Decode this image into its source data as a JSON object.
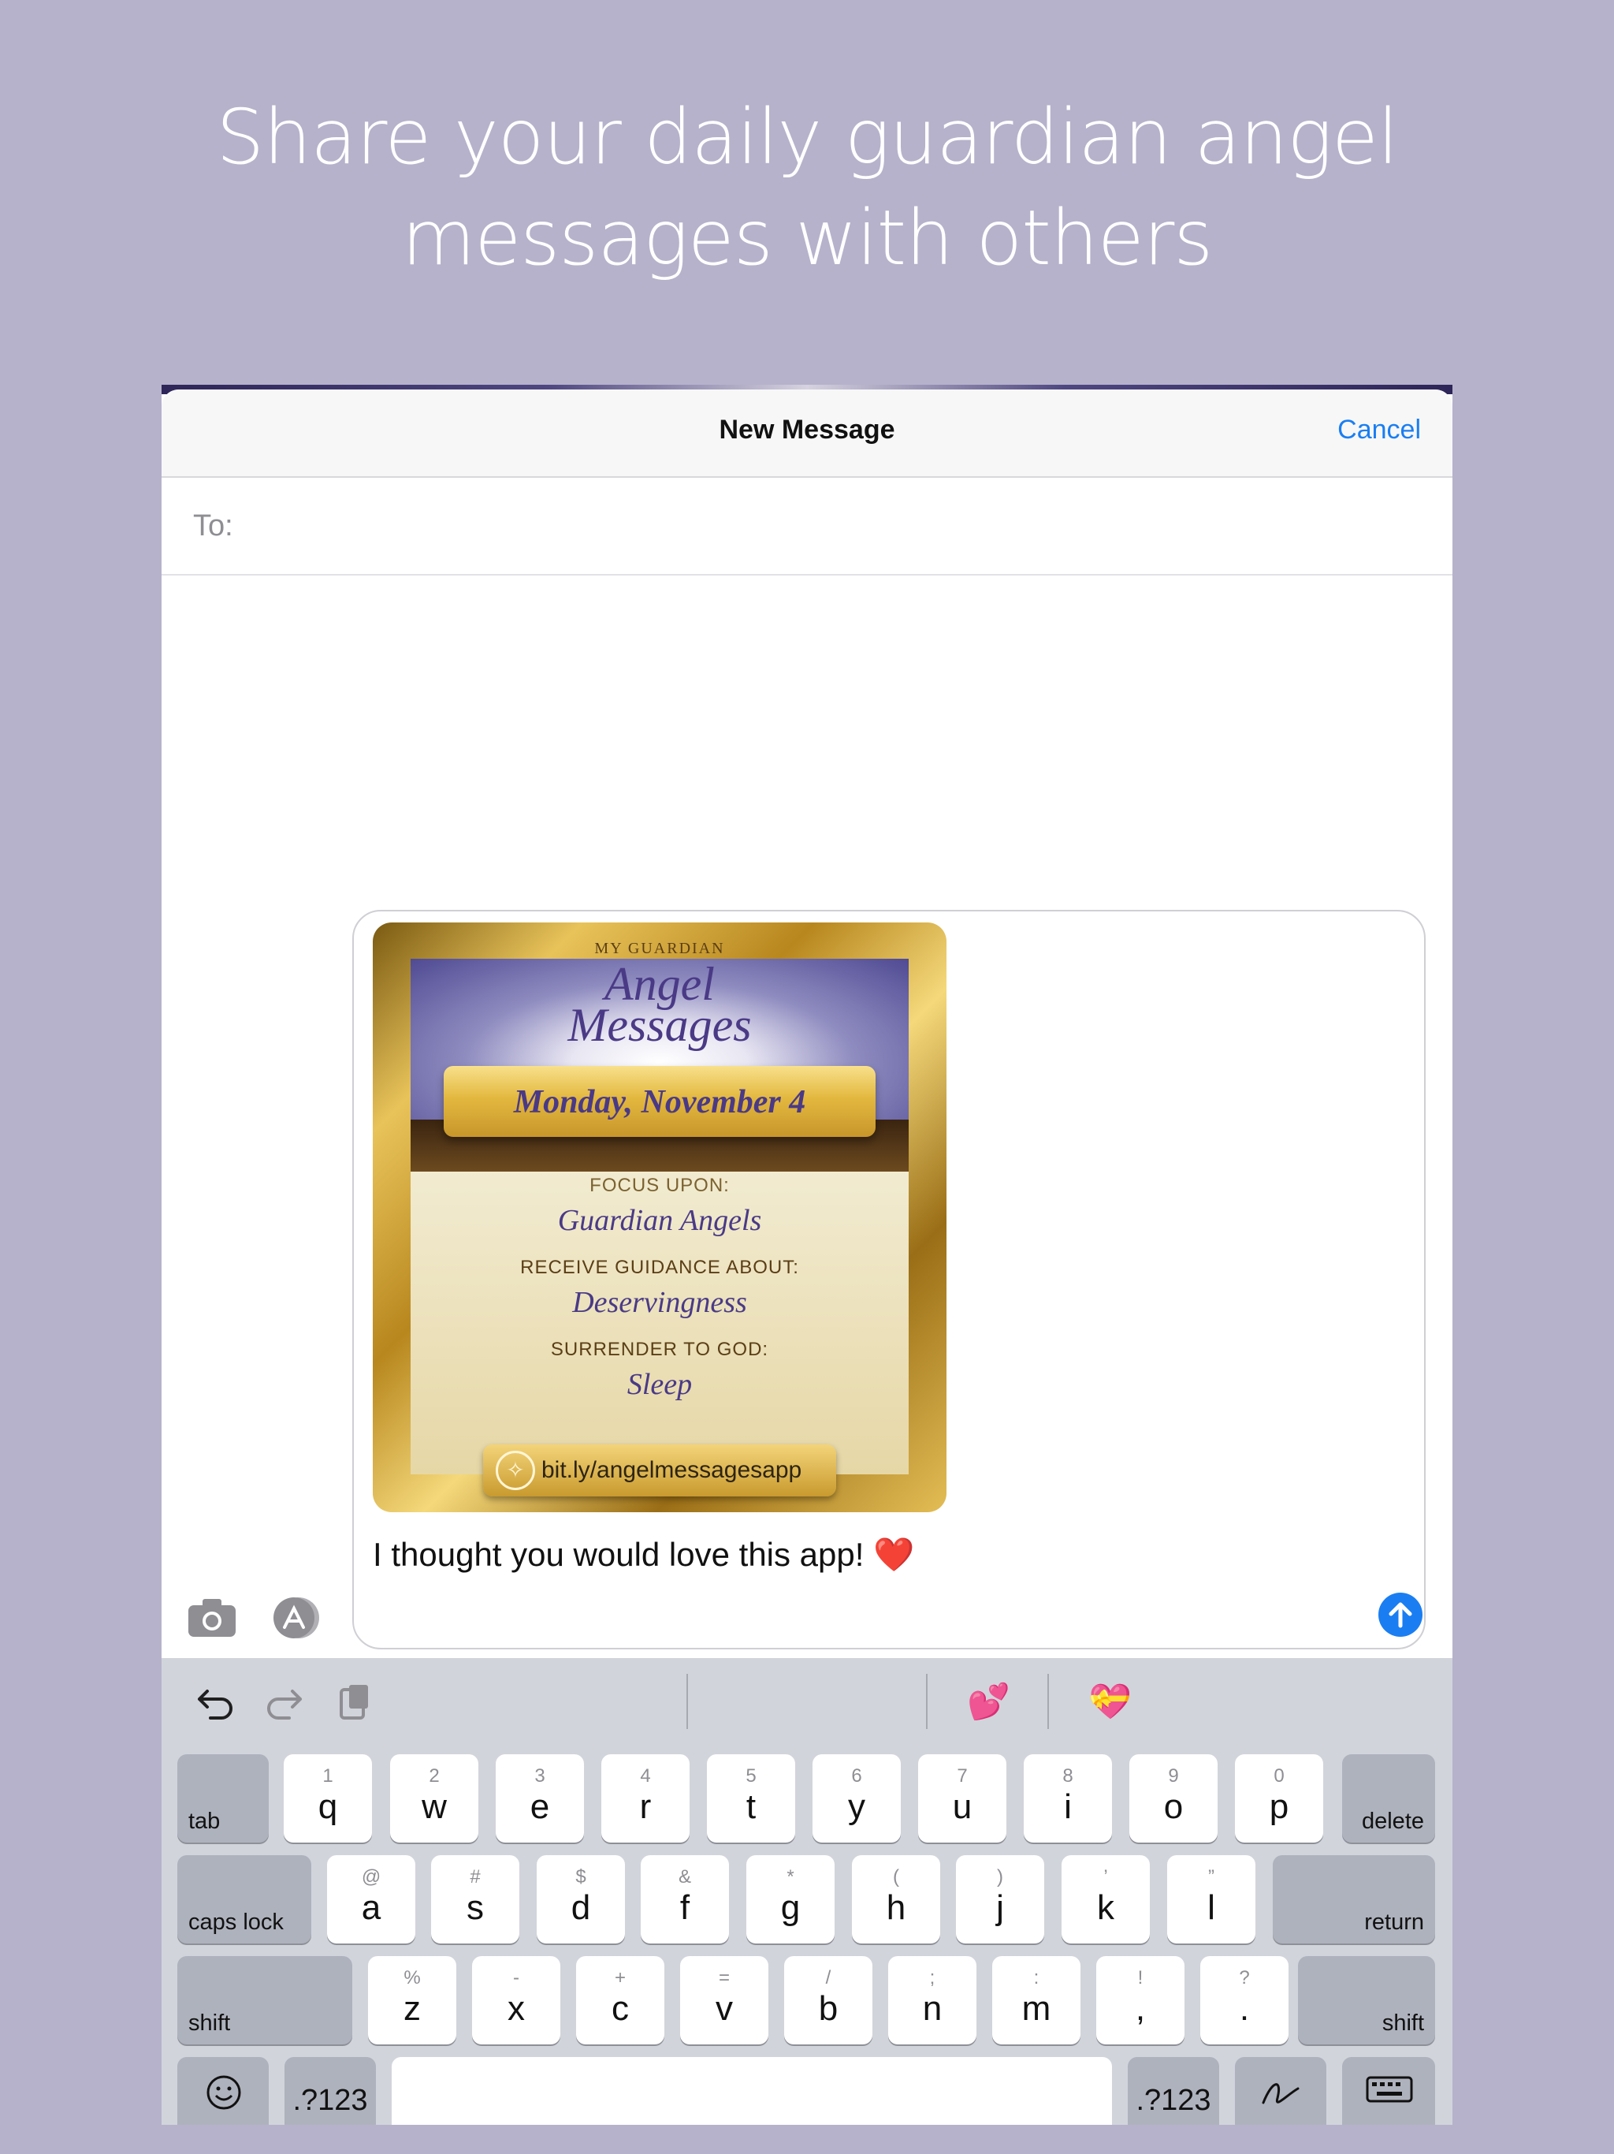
{
  "headline": {
    "line1": "Share your daily guardian angel",
    "line2": "messages with others"
  },
  "compose": {
    "title": "New Message",
    "cancel": "Cancel",
    "to_label": "To:",
    "message_text": "I thought you would love this app! ❤️"
  },
  "card": {
    "logo_top": "MY GUARDIAN",
    "logo_line1": "Angel",
    "logo_line2": "Messages",
    "date": "Monday, November 4",
    "focus_label": "FOCUS UPON:",
    "focus_value": "Guardian Angels",
    "guidance_label": "RECEIVE GUIDANCE ABOUT:",
    "guidance_value": "Deservingness",
    "surrender_label": "SURRENDER TO GOD:",
    "surrender_value": "Sleep",
    "link": "bit.ly/angelmessagesapp"
  },
  "toolbar": {
    "undo_icon": "undo-icon",
    "redo_icon": "redo-icon",
    "paste_icon": "paste-icon",
    "suggestion1": "💕",
    "suggestion2": "💝"
  },
  "keyboard": {
    "row1": [
      {
        "hint": "1",
        "key": "q"
      },
      {
        "hint": "2",
        "key": "w"
      },
      {
        "hint": "3",
        "key": "e"
      },
      {
        "hint": "4",
        "key": "r"
      },
      {
        "hint": "5",
        "key": "t"
      },
      {
        "hint": "6",
        "key": "y"
      },
      {
        "hint": "7",
        "key": "u"
      },
      {
        "hint": "8",
        "key": "i"
      },
      {
        "hint": "9",
        "key": "o"
      },
      {
        "hint": "0",
        "key": "p"
      }
    ],
    "row2": [
      {
        "hint": "@",
        "key": "a"
      },
      {
        "hint": "#",
        "key": "s"
      },
      {
        "hint": "$",
        "key": "d"
      },
      {
        "hint": "&",
        "key": "f"
      },
      {
        "hint": "*",
        "key": "g"
      },
      {
        "hint": "(",
        "key": "h"
      },
      {
        "hint": ")",
        "key": "j"
      },
      {
        "hint": "’",
        "key": "k"
      },
      {
        "hint": "”",
        "key": "l"
      }
    ],
    "row3": [
      {
        "hint": "%",
        "key": "z"
      },
      {
        "hint": "-",
        "key": "x"
      },
      {
        "hint": "+",
        "key": "c"
      },
      {
        "hint": "=",
        "key": "v"
      },
      {
        "hint": "/",
        "key": "b"
      },
      {
        "hint": ";",
        "key": "n"
      },
      {
        "hint": ":",
        "key": "m"
      },
      {
        "hint": "!",
        "key": ","
      },
      {
        "hint": "?",
        "key": "."
      }
    ],
    "tab": "tab",
    "delete": "delete",
    "caps_lock": "caps lock",
    "return": "return",
    "shift_left": "shift",
    "shift_right": "shift",
    "numbers_left": ".?123",
    "numbers_right": ".?123",
    "emoji_icon": "emoji-icon",
    "handwriting_icon": "handwriting-icon",
    "hide_keyboard_icon": "hide-keyboard-icon"
  }
}
